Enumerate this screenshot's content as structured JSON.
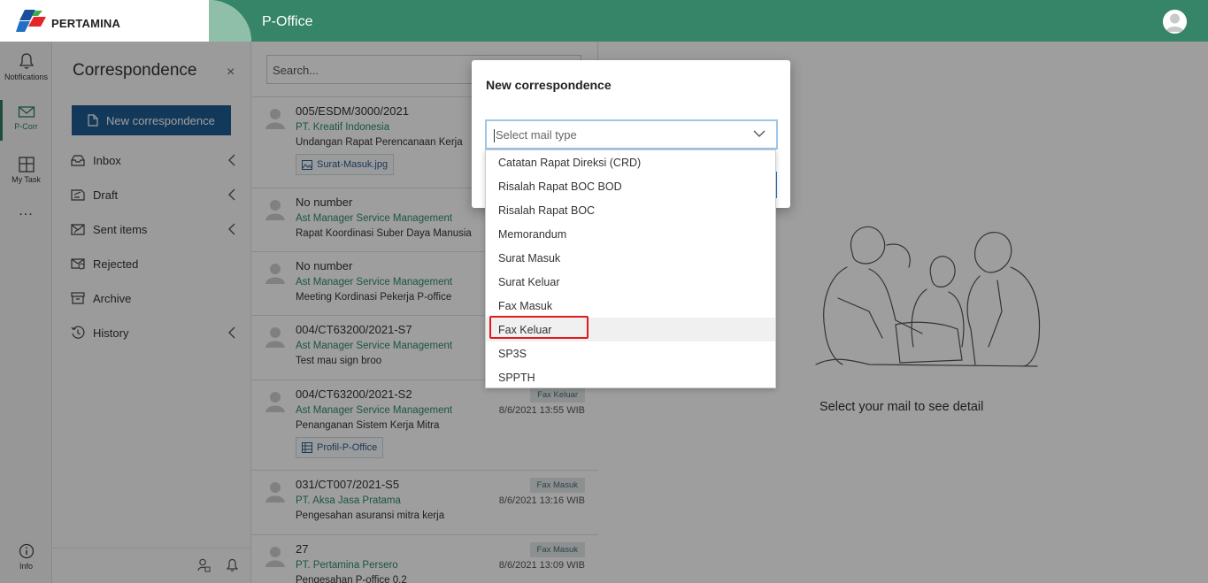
{
  "header": {
    "logo_text": "PERTAMINA",
    "app_title": "P-Office"
  },
  "rail": {
    "notifications": "Notifications",
    "pcorr": "P-Corr",
    "mytask": "My Task",
    "more": "...",
    "info": "Info"
  },
  "nav": {
    "title": "Correspondence",
    "close": "×",
    "new_button": "New correspondence",
    "items": [
      {
        "label": "Inbox"
      },
      {
        "label": "Draft"
      },
      {
        "label": "Sent items"
      },
      {
        "label": "Rejected"
      },
      {
        "label": "Archive"
      },
      {
        "label": "History"
      }
    ]
  },
  "list": {
    "search_placeholder": "Search...",
    "mails": [
      {
        "number": "005/ESDM/3000/2021",
        "from": "PT. Kreatif Indonesia",
        "subject": "Undangan Rapat Perencanaan Kerja",
        "attachment": "Surat-Masuk.jpg"
      },
      {
        "number": "No number",
        "from": "Ast Manager Service Management",
        "subject": "Rapat Koordinasi Suber Daya Manusia"
      },
      {
        "number": "No number",
        "from": "Ast Manager Service Management",
        "subject": "Meeting Kordinasi Pekerja P-office"
      },
      {
        "number": "004/CT63200/2021-S7",
        "from": "Ast Manager Service Management",
        "subject": "Test mau sign broo"
      },
      {
        "number": "004/CT63200/2021-S2",
        "from": "Ast Manager Service Management",
        "subject": "Penanganan Sistem Kerja Mitra",
        "attachment": "Profil-P-Office",
        "badge": "Fax Keluar",
        "date": "8/6/2021 13:55 WIB"
      },
      {
        "number": "031/CT007/2021-S5",
        "from": "PT. Aksa Jasa Pratama",
        "subject": "Pengesahan asuransi mitra kerja",
        "badge": "Fax Masuk",
        "date": "8/6/2021 13:16 WIB"
      },
      {
        "number": "27",
        "from": "PT. Pertamina Persero",
        "subject": "Pengesahan P-office 0.2",
        "badge": "Fax Masuk",
        "date": "8/6/2021 13:09 WIB"
      }
    ]
  },
  "detail": {
    "message": "Select your mail to see detail"
  },
  "modal": {
    "title": "New correspondence",
    "select_placeholder": "Select mail type",
    "options": [
      "Catatan Rapat Direksi (CRD)",
      "Risalah Rapat BOC BOD",
      "Risalah Rapat BOC",
      "Memorandum",
      "Surat Masuk",
      "Surat Keluar",
      "Fax Masuk",
      "Fax Keluar",
      "SP3S",
      "SPPTH"
    ],
    "highlighted_option": "Fax Keluar"
  },
  "colors": {
    "header_green": "#368568",
    "primary_blue": "#1f5c92",
    "link_green": "#2e8a6b",
    "annotation_red": "#e3191b"
  }
}
